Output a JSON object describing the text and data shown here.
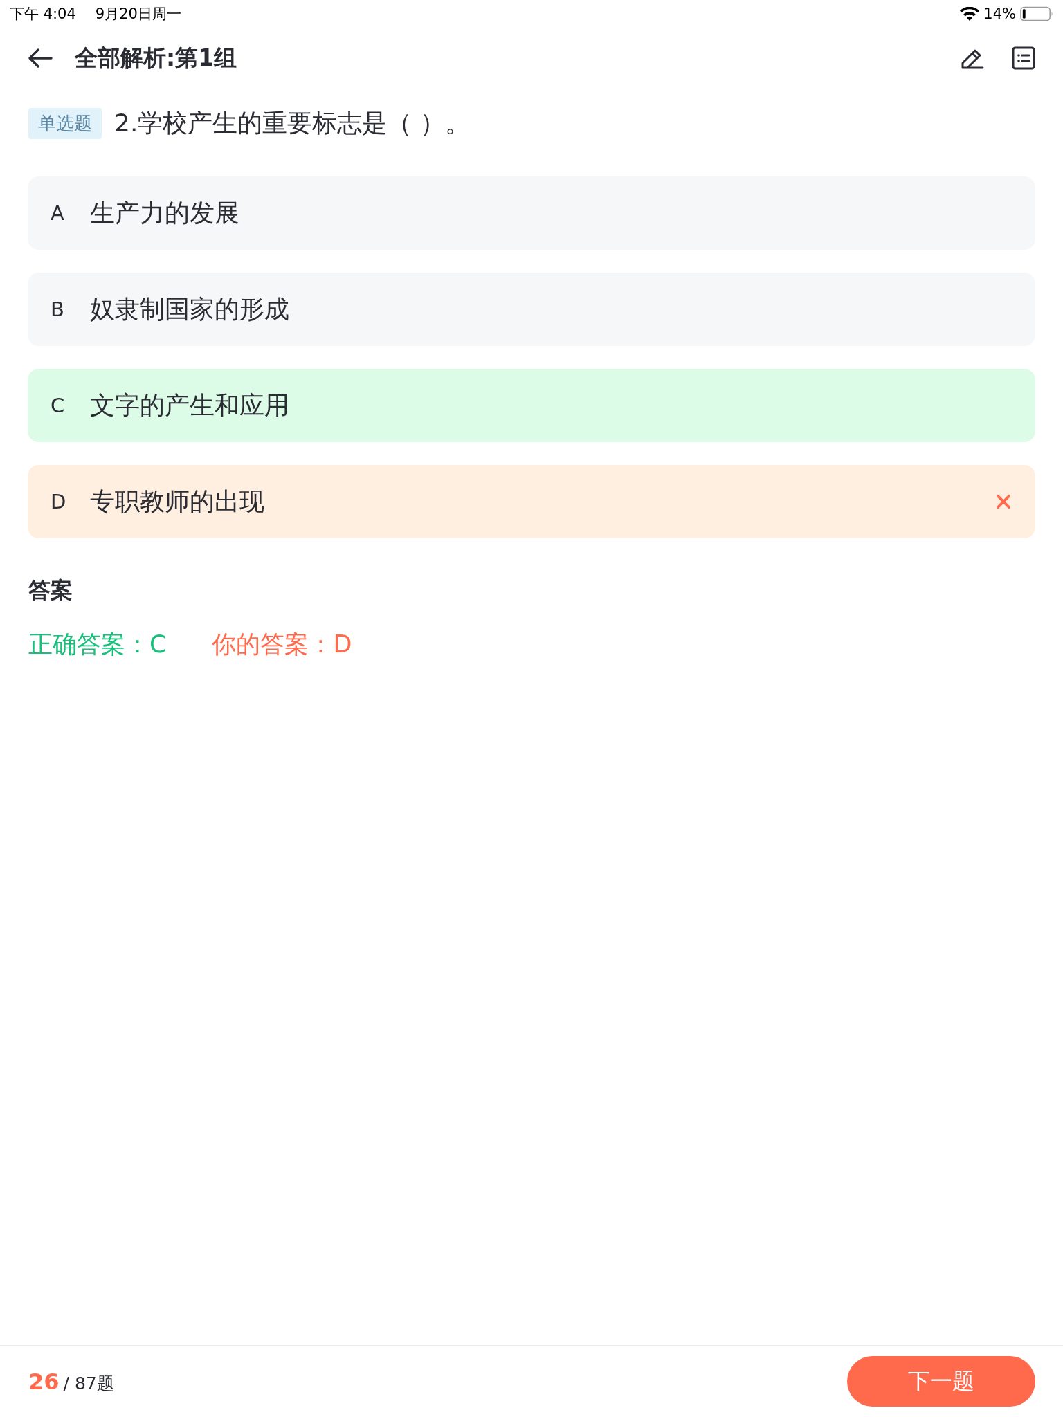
{
  "status_bar": {
    "time": "下午 4:04",
    "date": "9月20日周一",
    "battery": "14%"
  },
  "header": {
    "title": "全部解析:第1组"
  },
  "question": {
    "type_tag": "单选题",
    "text": "2.学校产生的重要标志是（ ）。"
  },
  "options": [
    {
      "letter": "A",
      "text": "生产力的发展",
      "correct": false,
      "selected": false
    },
    {
      "letter": "B",
      "text": "奴隶制国家的形成",
      "correct": false,
      "selected": false
    },
    {
      "letter": "C",
      "text": "文字的产生和应用",
      "correct": true,
      "selected": false
    },
    {
      "letter": "D",
      "text": "专职教师的出现",
      "correct": false,
      "selected": true
    }
  ],
  "answer": {
    "heading": "答案",
    "correct_answer": "正确答案：C",
    "your_answer": "你的答案：D"
  },
  "footer": {
    "current": "26",
    "total": "/ 87题",
    "next_button": "下一题"
  }
}
